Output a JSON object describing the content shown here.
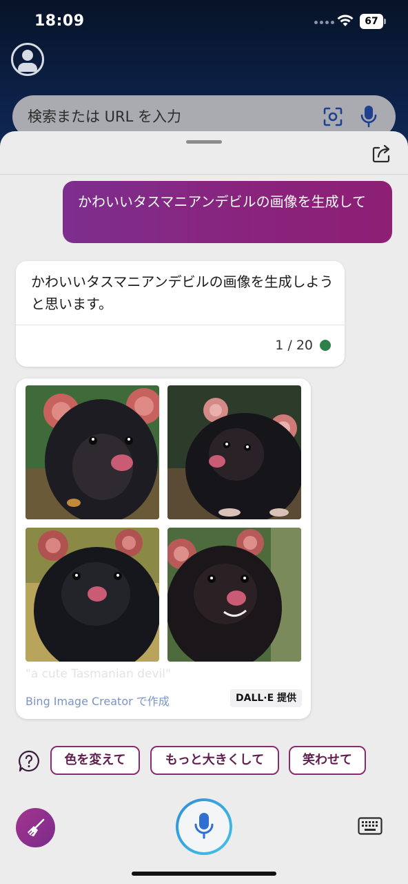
{
  "status": {
    "time": "18:09",
    "battery": "67"
  },
  "search": {
    "placeholder": "検索または URL を入力"
  },
  "chat": {
    "user_message": "かわいいタスマニアンデビルの画像を生成して",
    "bot_message": "かわいいタスマニアンデビルの画像を生成しようと思います。",
    "turn_counter": "1 / 20"
  },
  "image_card": {
    "caption": "\"a cute Tasmanian devil\"",
    "creator_label": "Bing Image Creator で作成",
    "provider_badge": "DALL·E 提供",
    "images": [
      {
        "subject": "tasmanian-devil"
      },
      {
        "subject": "tasmanian-devil"
      },
      {
        "subject": "tasmanian-devil"
      },
      {
        "subject": "tasmanian-devil"
      }
    ]
  },
  "suggestions": [
    "色を変えて",
    "もっと大きくして",
    "笑わせて"
  ],
  "colors": {
    "accent": "#8a237c",
    "mic_ring": "#2f8fd8",
    "status_dot": "#2f7f48",
    "link": "#7a93c9"
  },
  "icons": {
    "profile": "avatar-icon",
    "scan": "visual-search-icon",
    "mic": "microphone-icon",
    "share": "share-icon",
    "help": "help-bubble-icon",
    "new_topic": "broom-icon",
    "keyboard": "keyboard-icon"
  }
}
